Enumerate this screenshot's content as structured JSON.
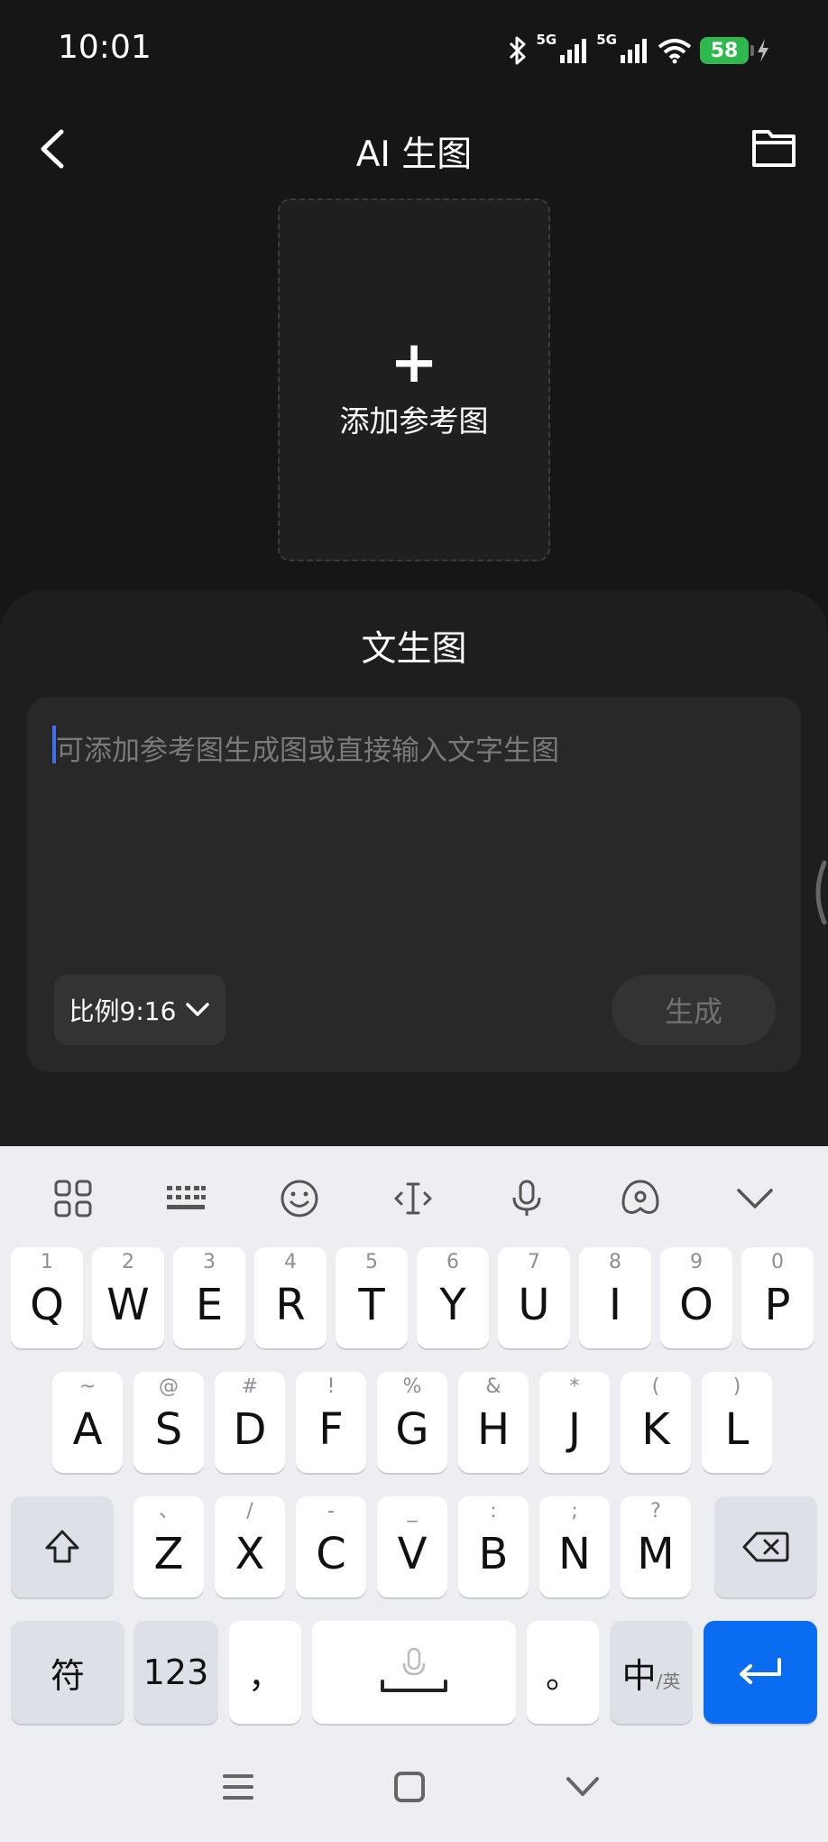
{
  "status_bar": {
    "time": "10:01",
    "network_1": "5G",
    "network_2": "5G",
    "battery": "58"
  },
  "header": {
    "title": "AI 生图"
  },
  "reference": {
    "plus": "+",
    "label": "添加参考图"
  },
  "sheet": {
    "title": "文生图",
    "prompt_placeholder": "可添加参考图生成图或直接输入文字生图",
    "ratio_label": "比例9:16",
    "generate_label": "生成"
  },
  "keyboard": {
    "row1": [
      {
        "main": "Q",
        "sub": "1"
      },
      {
        "main": "W",
        "sub": "2"
      },
      {
        "main": "E",
        "sub": "3"
      },
      {
        "main": "R",
        "sub": "4"
      },
      {
        "main": "T",
        "sub": "5"
      },
      {
        "main": "Y",
        "sub": "6"
      },
      {
        "main": "U",
        "sub": "7"
      },
      {
        "main": "I",
        "sub": "8"
      },
      {
        "main": "O",
        "sub": "9"
      },
      {
        "main": "P",
        "sub": "0"
      }
    ],
    "row2": [
      {
        "main": "A",
        "sub": "~"
      },
      {
        "main": "S",
        "sub": "@"
      },
      {
        "main": "D",
        "sub": "#"
      },
      {
        "main": "F",
        "sub": "!"
      },
      {
        "main": "G",
        "sub": "%"
      },
      {
        "main": "H",
        "sub": "&"
      },
      {
        "main": "J",
        "sub": "*"
      },
      {
        "main": "K",
        "sub": "("
      },
      {
        "main": "L",
        "sub": ")"
      }
    ],
    "row3": [
      {
        "main": "Z",
        "sub": "、"
      },
      {
        "main": "X",
        "sub": "/"
      },
      {
        "main": "C",
        "sub": "-"
      },
      {
        "main": "V",
        "sub": "_"
      },
      {
        "main": "B",
        "sub": ":"
      },
      {
        "main": "N",
        "sub": ";"
      },
      {
        "main": "M",
        "sub": "?"
      }
    ],
    "symbols_label": "符",
    "numbers_label": "123",
    "comma_label": "，",
    "period_label": "。",
    "lang_main": "中",
    "lang_sub": "/英"
  },
  "colors": {
    "accent_blue": "#0a6cf0",
    "battery_green": "#2fb84f",
    "caret": "#3f6df2"
  }
}
